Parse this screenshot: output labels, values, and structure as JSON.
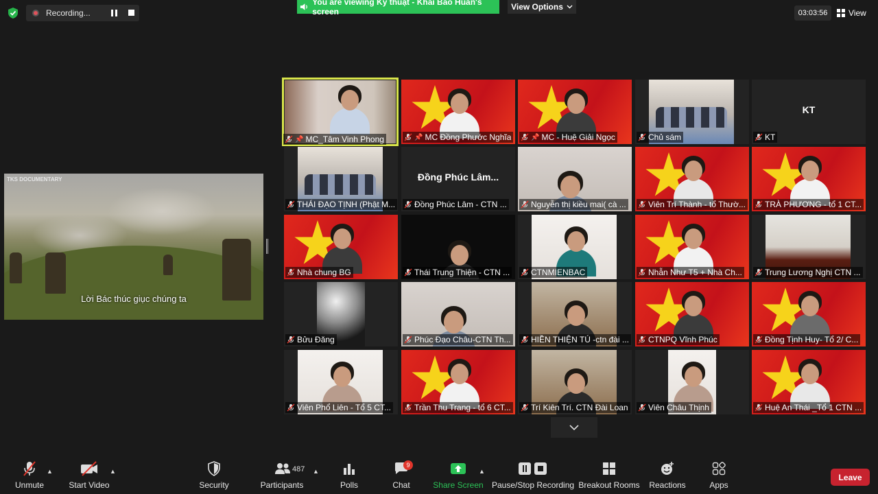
{
  "top": {
    "recording_label": "Recording...",
    "viewing_banner": "You are viewing Kỹ thuật - Khải Bảo Huấn's screen",
    "view_options": "View Options",
    "timer": "03:03:56",
    "view_label": "View"
  },
  "share": {
    "watermark": "TKS DOCUMENTARY",
    "caption": "Lời Bác thúc giục chúng ta"
  },
  "tiles": [
    {
      "name": "MC_Tâm Vinh Phong",
      "bg": "room",
      "pinned": true,
      "active": true
    },
    {
      "name": "MC Đồng Phước Nghĩa",
      "bg": "flag",
      "pinned": true
    },
    {
      "name": "MC - Huệ Giải Ngọc",
      "bg": "flag",
      "pinned": true
    },
    {
      "name": "Chủ sám",
      "bg": "group"
    },
    {
      "name": "KT",
      "bg": "dark",
      "big": "KT"
    },
    {
      "name": "THÁI ĐẠO TỊNH (Phật M...",
      "bg": "group2"
    },
    {
      "name": "Đồng Phúc Lâm -  CTN ...",
      "bg": "dark",
      "big": "Đồng Phúc Lâm..."
    },
    {
      "name": "Nguyễn thị kiều mai( cà ...",
      "bg": "light"
    },
    {
      "name": "Viên Trí Thành - tổ Thườ...",
      "bg": "flag"
    },
    {
      "name": "TRÀ PHƯƠNG - tổ 1 CT...",
      "bg": "flag"
    },
    {
      "name": "Nhà chung BG",
      "bg": "flag"
    },
    {
      "name": "Thái Trung Thiện - CTN ...",
      "bg": "black"
    },
    {
      "name": "CTNMIENBAC",
      "bg": "wall"
    },
    {
      "name": "Nhẫn Như T5 + Nhà Ch...",
      "bg": "flag"
    },
    {
      "name": "Trung Lương Nghị CTN ...",
      "bg": "room2"
    },
    {
      "name": "Bửu Đăng",
      "bg": "darkcam"
    },
    {
      "name": "Phúc Đạo Châu-CTN Th...",
      "bg": "light"
    },
    {
      "name": "HIỀN THIỆN TÚ -ctn đài ...",
      "bg": "room3"
    },
    {
      "name": "CTNPQ Vĩnh Phúc",
      "bg": "flag"
    },
    {
      "name": "Đồng Tịnh Huy- Tổ 2/ C...",
      "bg": "flag"
    },
    {
      "name": "Viên Phổ Liên - Tổ 5 CT...",
      "bg": "white"
    },
    {
      "name": "Trần Thu Trang - tổ 6 CT...",
      "bg": "flag"
    },
    {
      "name": "Trí Kiên Trí. CTN Đài Loan",
      "bg": "room4"
    },
    {
      "name": "Viên Châu Thịnh",
      "bg": "white2"
    },
    {
      "name": "Huệ An Thái _Tổ 1 CTN ...",
      "bg": "flag"
    }
  ],
  "toolbar": {
    "unmute": "Unmute",
    "start_video": "Start Video",
    "security": "Security",
    "participants": "Participants",
    "participants_count": "487",
    "polls": "Polls",
    "chat": "Chat",
    "chat_badge": "9",
    "share_screen": "Share Screen",
    "pause_stop_recording": "Pause/Stop Recording",
    "breakout_rooms": "Breakout Rooms",
    "reactions": "Reactions",
    "apps": "Apps",
    "leave": "Leave"
  },
  "colors": {
    "share_green": "#2cc257",
    "leave_red": "#c7232f",
    "active_border": "#d8e44a"
  }
}
